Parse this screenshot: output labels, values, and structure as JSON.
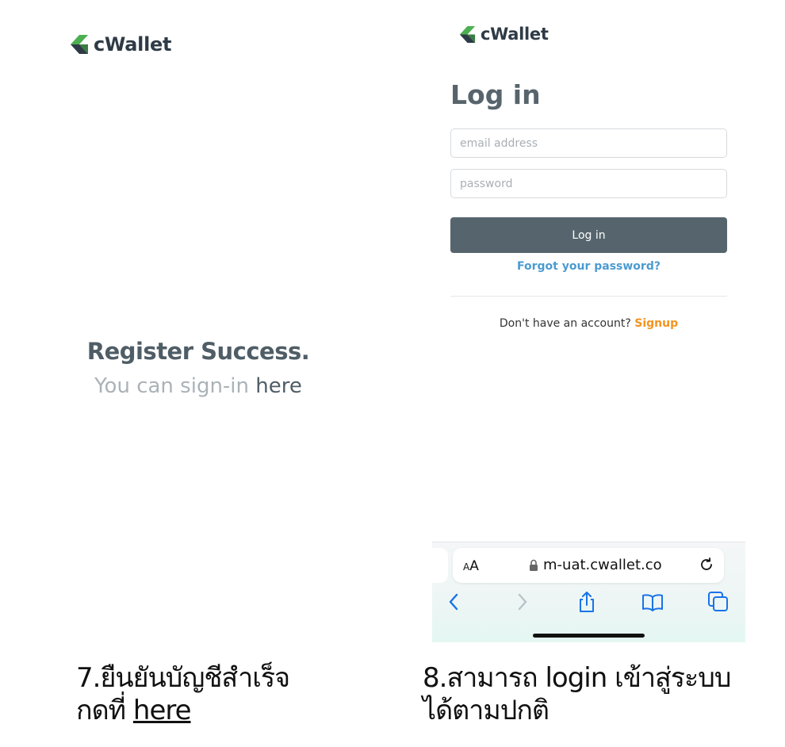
{
  "left_panel": {
    "logo_text": "cWallet",
    "success_title": "Register Success.",
    "success_sub_prefix": "You can sign-in ",
    "success_link": "here"
  },
  "right_panel": {
    "logo_text": "cWallet",
    "heading": "Log in",
    "email_placeholder": "email address",
    "password_placeholder": "password",
    "login_button": "Log in",
    "forgot_link": "Forgot your password?",
    "no_account_text": "Don't have an account? ",
    "signup_link": "Signup"
  },
  "safari_bar": {
    "aa_label": "AA",
    "url": "m-uat.cwallet.co",
    "icons": [
      "back-icon",
      "forward-icon",
      "share-icon",
      "bookmarks-icon",
      "tabs-icon",
      "reload-icon",
      "lock-icon"
    ]
  },
  "captions": {
    "left_line1": "7.ยืนยันบัญชีสำเร็จ",
    "left_line2_prefix": "กดที่ ",
    "left_line2_link": "here",
    "right_line1": "8.สามารถ login เข้าสู่ระบบ",
    "right_line2": "ได้ตามปกติ"
  },
  "colors": {
    "logo_green": "#3a9a4a",
    "logo_dark": "#2e3b46",
    "button": "#56656d",
    "forgot": "#4b9bd1",
    "signup": "#f5931e",
    "ios_blue": "#1a73e8"
  }
}
